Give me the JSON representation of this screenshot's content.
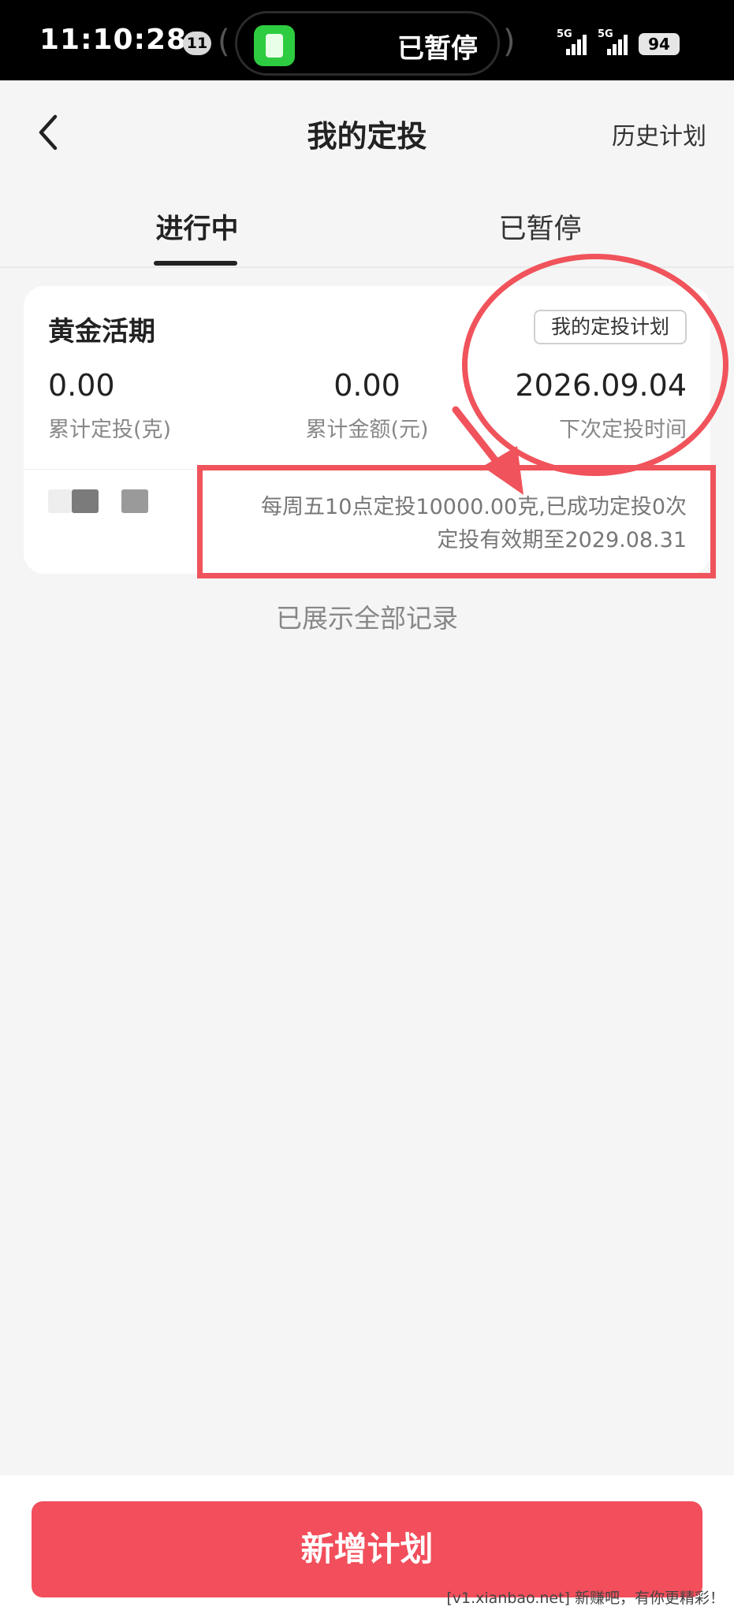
{
  "status_bar": {
    "time": "11:10:28",
    "notification_count": "11",
    "activity_text": "已暂停",
    "signal_1": "5G",
    "signal_2": "5G",
    "battery": "94"
  },
  "header": {
    "title": "我的定投",
    "history_link": "历史计划"
  },
  "tabs": [
    {
      "label": "进行中",
      "active": true
    },
    {
      "label": "已暂停",
      "active": false
    }
  ],
  "plan_card": {
    "title": "黄金活期",
    "plan_button": "我的定投计划",
    "stats": [
      {
        "value": "0.00",
        "label": "累计定投(克)"
      },
      {
        "value": "0.00",
        "label": "累计金额(元)"
      },
      {
        "value": "2026.09.04",
        "label": "下次定投时间"
      }
    ],
    "schedule_line1": "每周五10点定投10000.00克,已成功定投0次",
    "schedule_line2": "定投有效期至2029.08.31"
  },
  "list_footer": "已展示全部记录",
  "add_plan_button": "新增计划",
  "watermark": "[v1.xianbao.net] 新赚吧，有你更精彩！",
  "colors": {
    "accent": "#f24e5b",
    "annotation": "#f0535b",
    "background": "#f5f5f5"
  }
}
